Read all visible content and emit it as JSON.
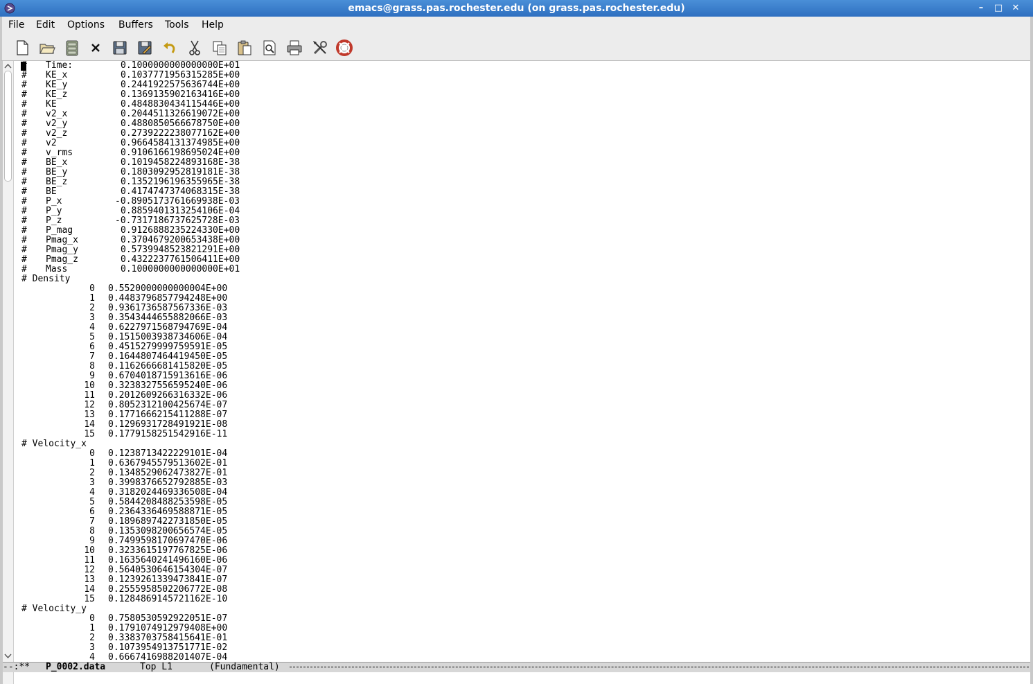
{
  "window": {
    "title": "emacs@grass.pas.rochester.edu (on grass.pas.rochester.edu)",
    "minimize": "–",
    "maximize": "□",
    "close": "✕"
  },
  "menu": [
    "File",
    "Edit",
    "Options",
    "Buffers",
    "Tools",
    "Help"
  ],
  "toolbar": [
    {
      "name": "new-file-icon"
    },
    {
      "name": "open-folder-icon"
    },
    {
      "name": "dired-icon"
    },
    {
      "name": "close-buffer-icon"
    },
    {
      "name": "save-icon"
    },
    {
      "name": "save-as-icon"
    },
    {
      "name": "undo-icon"
    },
    {
      "name": "cut-icon"
    },
    {
      "name": "copy-icon"
    },
    {
      "name": "paste-icon"
    },
    {
      "name": "search-icon"
    },
    {
      "name": "print-icon"
    },
    {
      "name": "customize-icon"
    },
    {
      "name": "help-icon"
    }
  ],
  "buffer_lines": [
    {
      "a": "#",
      "b": "Time:",
      "v": "0.1000000000000000E+01"
    },
    {
      "a": "#",
      "b": "KE_x",
      "v": "0.1037771956315285E+00"
    },
    {
      "a": "#",
      "b": "KE_y",
      "v": "0.2441922575636744E+00"
    },
    {
      "a": "#",
      "b": "KE_z",
      "v": "0.1369135902163416E+00"
    },
    {
      "a": "#",
      "b": "KE",
      "v": "0.4848830434115446E+00"
    },
    {
      "a": "#",
      "b": "v2_x",
      "v": "0.2044511326619072E+00"
    },
    {
      "a": "#",
      "b": "v2_y",
      "v": "0.4880850566678750E+00"
    },
    {
      "a": "#",
      "b": "v2_z",
      "v": "0.2739222238077162E+00"
    },
    {
      "a": "#",
      "b": "v2",
      "v": "0.9664584131374985E+00"
    },
    {
      "a": "#",
      "b": "v_rms",
      "v": "0.9106166198695024E+00"
    },
    {
      "a": "#",
      "b": "BE_x",
      "v": "0.1019458224893168E-38"
    },
    {
      "a": "#",
      "b": "BE_y",
      "v": "0.1803092952819181E-38"
    },
    {
      "a": "#",
      "b": "BE_z",
      "v": "0.1352196196355965E-38"
    },
    {
      "a": "#",
      "b": "BE",
      "v": "0.4174747374068315E-38"
    },
    {
      "a": "#",
      "b": "P_x",
      "v": "-0.8905173761669938E-03"
    },
    {
      "a": "#",
      "b": "P_y",
      "v": "0.8859401313254106E-04"
    },
    {
      "a": "#",
      "b": "P_z",
      "v": "-0.7317186737625728E-03"
    },
    {
      "a": "#",
      "b": "P_mag",
      "v": "0.9126888235224330E+00"
    },
    {
      "a": "#",
      "b": "Pmag_x",
      "v": "0.3704679200653438E+00"
    },
    {
      "a": "#",
      "b": "Pmag_y",
      "v": "0.5739948523821291E+00"
    },
    {
      "a": "#",
      "b": "Pmag_z",
      "v": "0.4322237761506411E+00"
    },
    {
      "a": "#",
      "b": "Mass",
      "v": "0.1000000000000000E+01"
    },
    {
      "h": "# Density"
    },
    {
      "i": "0",
      "v": "0.5520000000000004E+00"
    },
    {
      "i": "1",
      "v": "0.4483796857794248E+00"
    },
    {
      "i": "2",
      "v": "0.9361736587567336E-03"
    },
    {
      "i": "3",
      "v": "0.3543444655882066E-03"
    },
    {
      "i": "4",
      "v": "0.6227971568794769E-04"
    },
    {
      "i": "5",
      "v": "0.1515003938734606E-04"
    },
    {
      "i": "6",
      "v": "0.4515279999759591E-05"
    },
    {
      "i": "7",
      "v": "0.1644807464419450E-05"
    },
    {
      "i": "8",
      "v": "0.1162666681415820E-05"
    },
    {
      "i": "9",
      "v": "0.6704018715913616E-06"
    },
    {
      "i": "10",
      "v": "0.3238327556595240E-06"
    },
    {
      "i": "11",
      "v": "0.2012609266316332E-06"
    },
    {
      "i": "12",
      "v": "0.8052312100425674E-07"
    },
    {
      "i": "13",
      "v": "0.1771666215411288E-07"
    },
    {
      "i": "14",
      "v": "0.1296931728491921E-08"
    },
    {
      "i": "15",
      "v": "0.1779158251542916E-11"
    },
    {
      "h": "# Velocity_x"
    },
    {
      "i": "0",
      "v": "0.1238713422229101E-04"
    },
    {
      "i": "1",
      "v": "0.6367945579513602E-01"
    },
    {
      "i": "2",
      "v": "0.1348529062473827E-01"
    },
    {
      "i": "3",
      "v": "0.3998376652792885E-03"
    },
    {
      "i": "4",
      "v": "0.3182024469336508E-04"
    },
    {
      "i": "5",
      "v": "0.5844208488253598E-05"
    },
    {
      "i": "6",
      "v": "0.2364336469588871E-05"
    },
    {
      "i": "7",
      "v": "0.1896897422731850E-05"
    },
    {
      "i": "8",
      "v": "0.1353098200656574E-05"
    },
    {
      "i": "9",
      "v": "0.7499598170697470E-06"
    },
    {
      "i": "10",
      "v": "0.3233615197767825E-06"
    },
    {
      "i": "11",
      "v": "0.1635640241496160E-06"
    },
    {
      "i": "12",
      "v": "0.5640530646154304E-07"
    },
    {
      "i": "13",
      "v": "0.1239261339473841E-07"
    },
    {
      "i": "14",
      "v": "0.2555958502206772E-08"
    },
    {
      "i": "15",
      "v": "0.1284869145721162E-10"
    },
    {
      "h": "# Velocity_y"
    },
    {
      "i": "0",
      "v": "0.7580530592922051E-07"
    },
    {
      "i": "1",
      "v": "0.1791074912979408E+00"
    },
    {
      "i": "2",
      "v": "0.3383703758415641E-01"
    },
    {
      "i": "3",
      "v": "0.1073954913751771E-02"
    },
    {
      "i": "4",
      "v": "0.6667416988201407E-04"
    }
  ],
  "modeline": {
    "status": "--:**",
    "buffer": "P_0002.data",
    "position": "Top L1",
    "mode": "(Fundamental)"
  }
}
